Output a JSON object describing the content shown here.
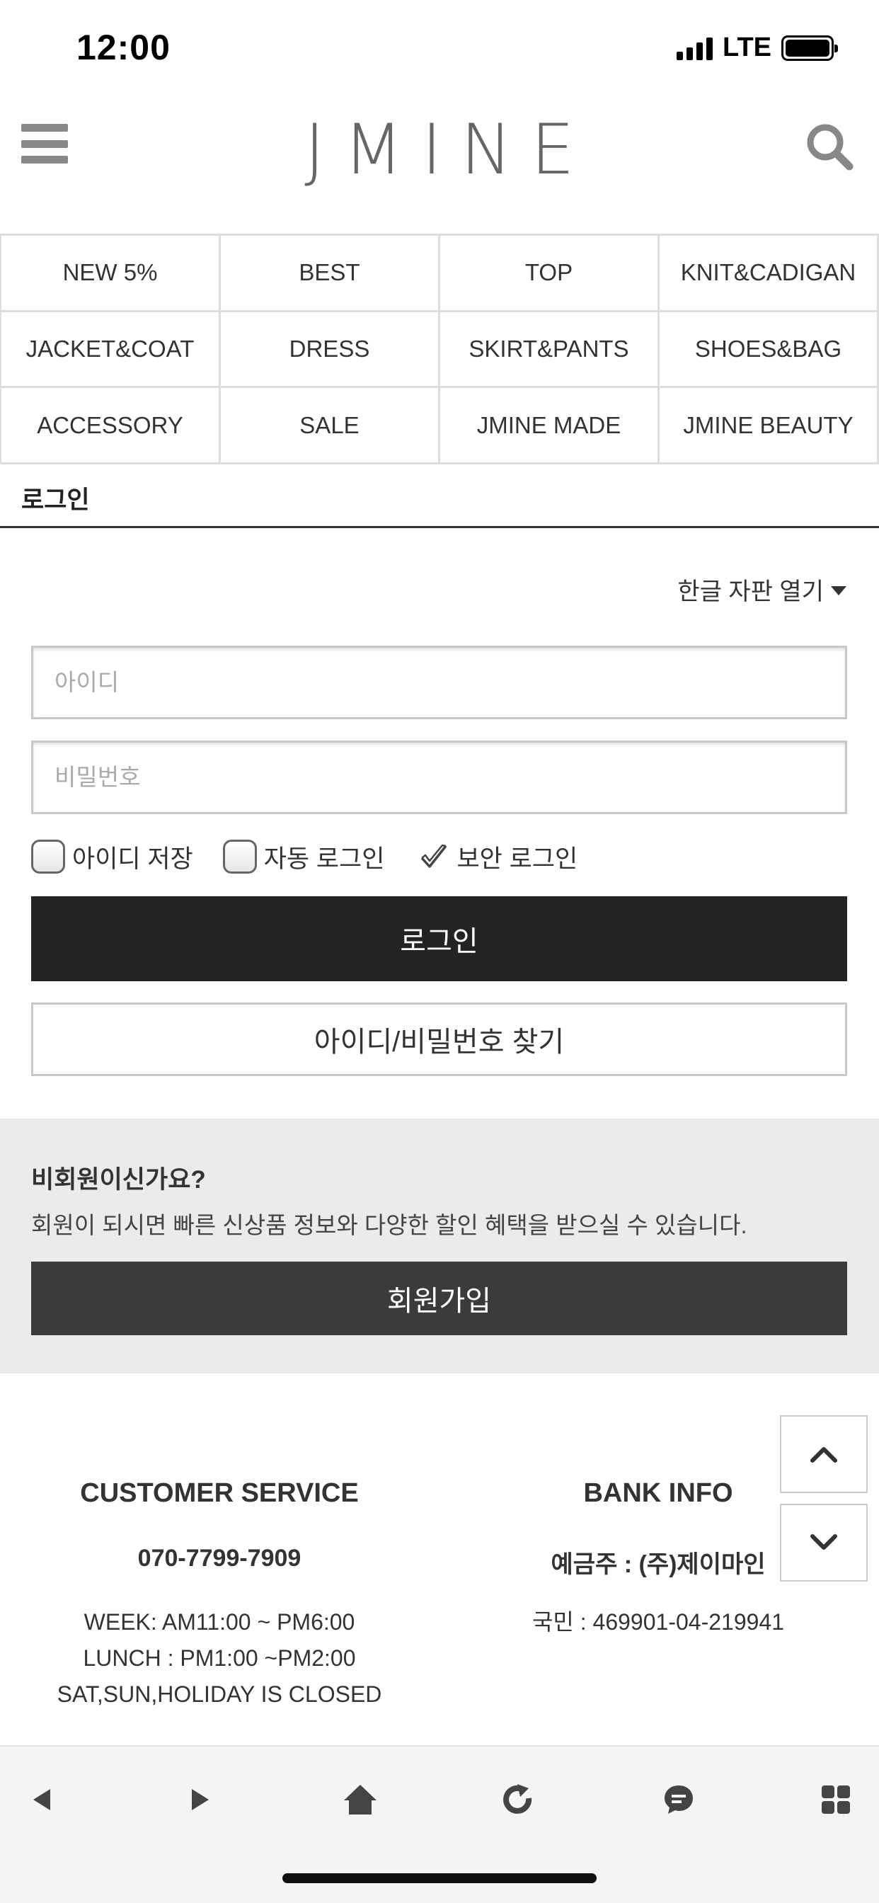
{
  "status_bar": {
    "time": "12:00",
    "network": "LTE",
    "icons": [
      "signal-icon",
      "battery-icon"
    ]
  },
  "header": {
    "logo": "JMINE",
    "icons": [
      "menu-icon",
      "search-icon"
    ]
  },
  "categories": [
    "NEW 5%",
    "BEST",
    "TOP",
    "KNIT&CADIGAN",
    "JACKET&COAT",
    "DRESS",
    "SKIRT&PANTS",
    "SHOES&BAG",
    "ACCESSORY",
    "SALE",
    "JMINE MADE",
    "JMINE BEAUTY"
  ],
  "page": {
    "title": "로그인",
    "keyboard_toggle": "한글 자판 열기"
  },
  "login_form": {
    "id_placeholder": "아이디",
    "password_placeholder": "비밀번호",
    "save_id_label": "아이디 저장",
    "save_id_checked": false,
    "auto_login_label": "자동 로그인",
    "auto_login_checked": false,
    "secure_login_label": "보안 로그인",
    "secure_login_checked": true,
    "login_button": "로그인",
    "find_button": "아이디/비밀번호 찾기"
  },
  "guest": {
    "title": "비회원이신가요?",
    "description": "회원이 되시면 빠른 신상품 정보와 다양한 할인 혜택을 받으실 수 있습니다.",
    "join_button": "회원가입"
  },
  "footer": {
    "customer_service": {
      "heading": "CUSTOMER SERVICE",
      "phone": "070-7799-7909",
      "hours": [
        "WEEK: AM11:00 ~ PM6:00",
        "LUNCH : PM1:00 ~PM2:00",
        "SAT,SUN,HOLIDAY IS CLOSED"
      ]
    },
    "bank_info": {
      "heading": "BANK INFO",
      "holder": "예금주 : (주)제이마인",
      "account": "국민 : 469901-04-219941"
    },
    "scroll_icons": [
      "chevron-up-icon",
      "chevron-down-icon"
    ]
  },
  "browser_toolbar": {
    "icons": [
      "back-icon",
      "forward-icon",
      "home-icon",
      "refresh-icon",
      "chat-icon",
      "apps-grid-icon"
    ]
  },
  "colors": {
    "primary_button": "#232323",
    "join_button": "#3b3b3b",
    "guest_background": "#ebebeb",
    "toolbar_background": "#f4f4f4",
    "logo": "#666666"
  }
}
